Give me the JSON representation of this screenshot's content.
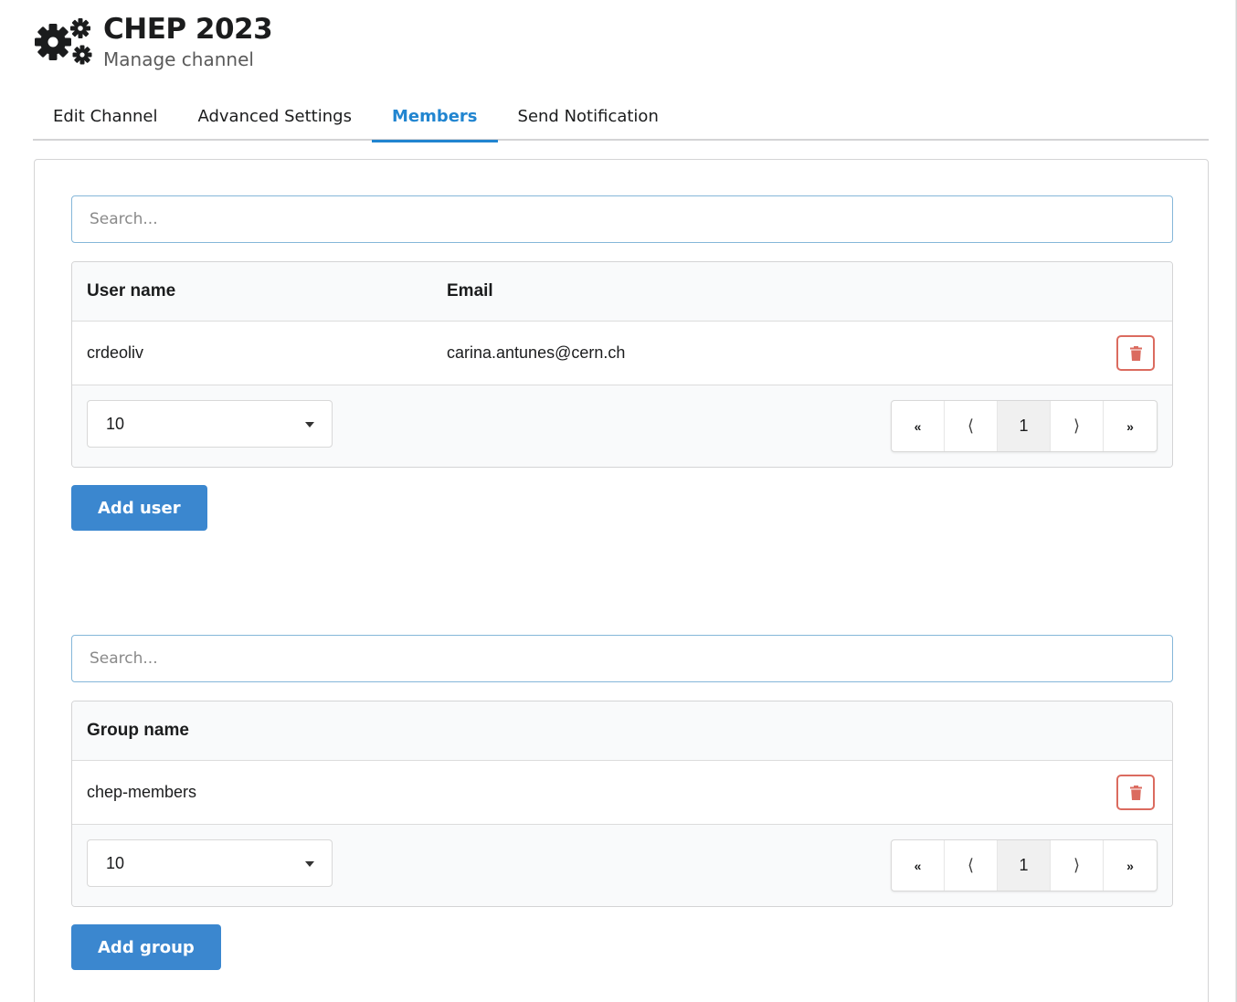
{
  "header": {
    "title": "CHEP 2023",
    "subtitle": "Manage channel",
    "icon": "gears-icon"
  },
  "tabs": [
    {
      "label": "Edit Channel",
      "active": false
    },
    {
      "label": "Advanced Settings",
      "active": false
    },
    {
      "label": "Members",
      "active": true
    },
    {
      "label": "Send Notification",
      "active": false
    }
  ],
  "users": {
    "search_placeholder": "Search...",
    "columns": [
      "User name",
      "Email"
    ],
    "rows": [
      {
        "username": "crdeoliv",
        "email": "carina.antunes@cern.ch"
      }
    ],
    "page_size": "10",
    "pager": {
      "first": "«",
      "prev": "⟨",
      "current": "1",
      "next": "⟩",
      "last": "»"
    },
    "add_label": "Add user"
  },
  "groups": {
    "search_placeholder": "Search...",
    "columns": [
      "Group name"
    ],
    "rows": [
      {
        "name": "chep-members"
      }
    ],
    "page_size": "10",
    "pager": {
      "first": "«",
      "prev": "⟨",
      "current": "1",
      "next": "⟩",
      "last": "»"
    },
    "add_label": "Add group"
  },
  "colors": {
    "accent": "#2185d0",
    "primary_button": "#3b87cf",
    "delete": "#db6b5f"
  }
}
